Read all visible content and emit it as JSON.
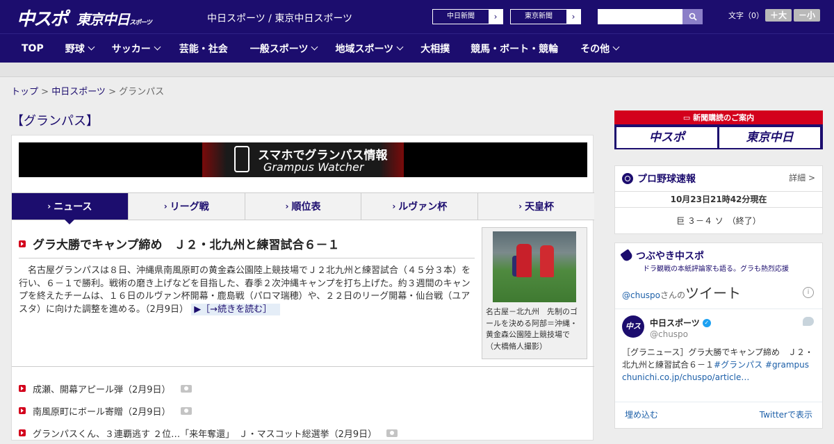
{
  "header": {
    "logo_chuspo": "中スポ",
    "logo_tokyo": "東京中日",
    "logo_tokyo_small": "スポーツ",
    "site_names": "中日スポーツ / 東京中日スポーツ",
    "paper_buttons": [
      "中日新聞",
      "東京新聞"
    ],
    "search_placeholder": "",
    "font_label": "文字（0）",
    "font_larger": "＋大",
    "font_smaller": "－小"
  },
  "nav": {
    "items": [
      {
        "label": "TOP",
        "dropdown": false
      },
      {
        "label": "野球",
        "dropdown": true
      },
      {
        "label": "サッカー",
        "dropdown": true
      },
      {
        "label": "芸能・社会",
        "dropdown": false
      },
      {
        "label": "一般スポーツ",
        "dropdown": true
      },
      {
        "label": "地域スポーツ",
        "dropdown": true
      },
      {
        "label": "大相撲",
        "dropdown": false
      },
      {
        "label": "競馬・ボート・競輪",
        "dropdown": false
      },
      {
        "label": "その他",
        "dropdown": true
      }
    ]
  },
  "breadcrumb": {
    "top": "トップ",
    "sep": " > ",
    "section": "中日スポーツ",
    "current": "グランパス"
  },
  "page_title": "【グランパス】",
  "banner": {
    "line1": "スマホでグランパス情報",
    "line2": "Grampus Watcher"
  },
  "tabs": [
    "ニュース",
    "リーグ戦",
    "順位表",
    "ルヴァン杯",
    "天皇杯"
  ],
  "article": {
    "headline": "グラ大勝でキャンプ締め　Ｊ２・北九州と練習試合６－１",
    "body": "名古屋グランパスは８日、沖縄県南風原町の黄金森公園陸上競技場でＪ２北九州と練習試合（４５分３本）を行い、６－１で勝利。戦術の磨き上げなどを目指した、春季２次沖縄キャンプを打ち上げた。約３週間のキャンプを終えたチームは、１６日のルヴァン杯開幕・鹿島戦（パロマ瑞穂）や、２２日のリーグ開幕・仙台戦（ユアスタ）に向けた調整を進める。（2月9日）",
    "more": "▶［→続きを読む］",
    "photo_caption": "名古屋－北九州　先制のゴールを決める阿部＝沖縄・黄金森公園陸上競技場で（大橋脩人撮影）"
  },
  "news_list": [
    "成瀬、開幕アピール弾（2月9日）",
    "南風原町にボール寄贈（2月9日）",
    "グランパスくん、３連覇逃す ２位…「来年奪還」　Ｊ・マスコット総選挙（2月9日）"
  ],
  "subscription": {
    "heading": "新聞購読のご案内",
    "btn1": "中スポ",
    "btn2": "東京中日"
  },
  "baseball": {
    "title": "プロ野球速報",
    "detail": "詳細 >",
    "time": "10月23日21時42分現在",
    "score": "巨 ３－４ ソ　（終了）"
  },
  "twitter": {
    "title": "つぶやき中スポ",
    "subtitle": "ドラ観戦の本紙評論家も語る。グラも熱烈応援",
    "handle_link": "@chuspo",
    "handle_suffix": "さんの",
    "header_big": "ツイート",
    "name": "中日スポーツ",
    "handle": "@chuspo",
    "tweet_prefix": "［グラニュース］グラ大勝でキャンプ締め　Ｊ２・北九州と練習試合６－１",
    "tweet_tags": "#グランパス #grampus",
    "tweet_link": "chunichi.co.jp/chuspo/article…",
    "embed": "埋め込む",
    "view_on": "Twitterで表示"
  }
}
